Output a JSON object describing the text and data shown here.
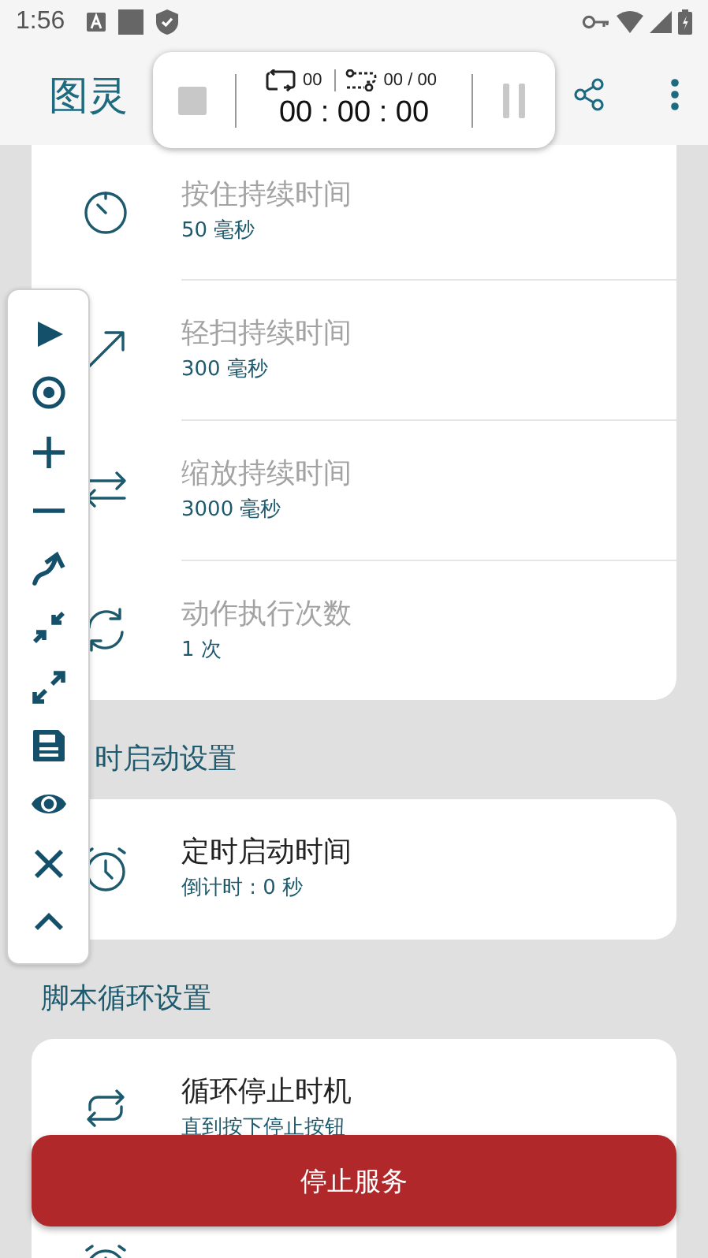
{
  "status_bar": {
    "time": "1:56"
  },
  "app_bar": {
    "title": "图灵"
  },
  "timer_overlay": {
    "loop_count": "00",
    "step_count": "00 / 00",
    "elapsed": "00 : 00 : 00"
  },
  "sections": [
    {
      "items": [
        {
          "kind": "timer",
          "title": "按住持续时间",
          "subtitle": "50 毫秒",
          "disabled": true
        },
        {
          "kind": "swipe",
          "title": "轻扫持续时间",
          "subtitle": "300 毫秒",
          "disabled": true
        },
        {
          "kind": "pinch",
          "title": "缩放持续时间",
          "subtitle": "3000 毫秒",
          "disabled": true
        },
        {
          "kind": "repeat",
          "title": "动作执行次数",
          "subtitle": "1 次",
          "disabled": true
        }
      ]
    },
    {
      "header": "时启动设置",
      "items": [
        {
          "kind": "alarm",
          "title": "定时启动时间",
          "subtitle": "倒计时 : 0 秒",
          "disabled": false
        }
      ]
    },
    {
      "header": "脚本循环设置",
      "items": [
        {
          "kind": "loop",
          "title": "循环停止时机",
          "subtitle": "直到按下停止按钮",
          "disabled": false
        },
        {
          "kind": "alarm"
        }
      ]
    }
  ],
  "floating_toolbar": [
    {
      "kind": "play"
    },
    {
      "kind": "target"
    },
    {
      "kind": "add"
    },
    {
      "kind": "remove"
    },
    {
      "kind": "curve"
    },
    {
      "kind": "collapse"
    },
    {
      "kind": "expand"
    },
    {
      "kind": "save"
    },
    {
      "kind": "eye"
    },
    {
      "kind": "close"
    },
    {
      "kind": "up"
    }
  ],
  "stop_button": {
    "label": "停止服务"
  }
}
